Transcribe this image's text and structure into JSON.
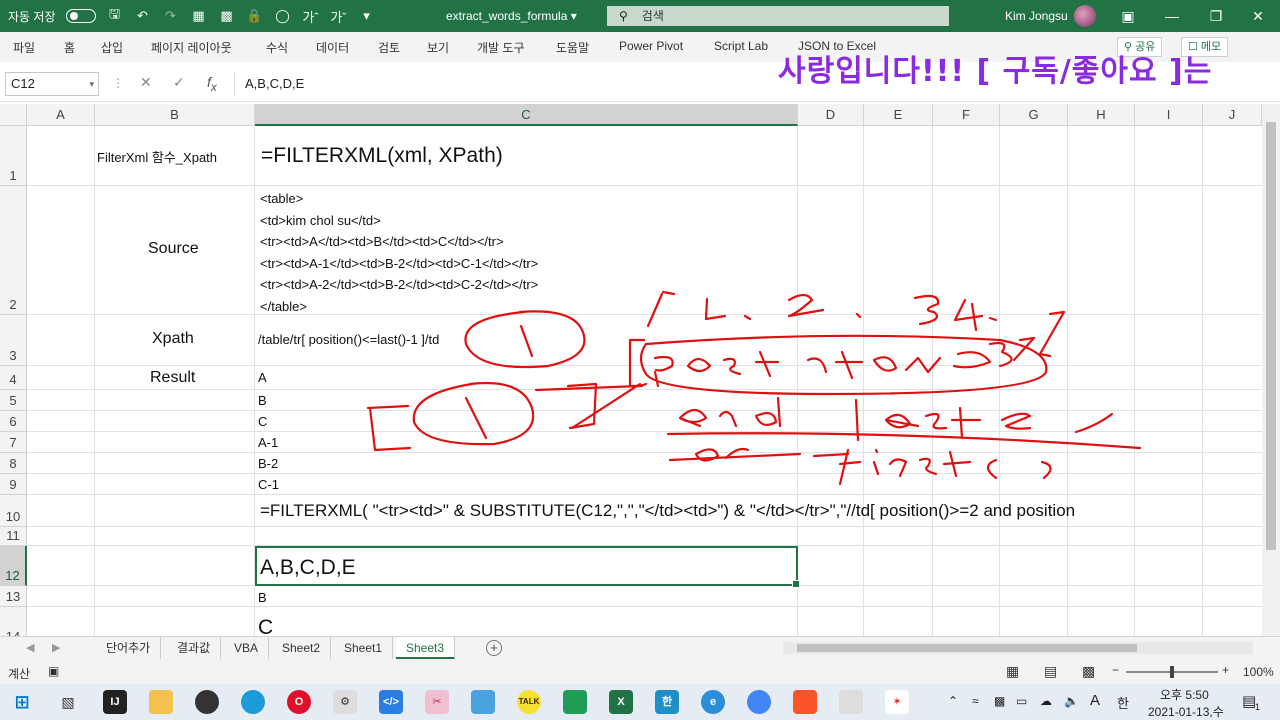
{
  "titlebar": {
    "autosave_label": "자동 저장",
    "filename": "extract_words_formula",
    "search_placeholder": "검색",
    "user_name": "Kim Jongsu"
  },
  "ribbon": {
    "tabs": [
      "파일",
      "홈",
      "삽입",
      "페이지 레이아웃",
      "수식",
      "데이터",
      "검토",
      "보기",
      "개발 도구",
      "도움말",
      "Power Pivot",
      "Script Lab",
      "JSON to Excel"
    ],
    "share_label": "공유",
    "memo_label": "메모"
  },
  "overlay_caption": "사랑입니다!!!   [   구독/좋아요 ]는",
  "formula_bar": {
    "name_box": "C12",
    "formula": "A,B,C,D,E"
  },
  "columns": [
    "A",
    "B",
    "C",
    "D",
    "E",
    "F",
    "G",
    "H",
    "I",
    "J"
  ],
  "rows": [
    "1",
    "2",
    "3",
    "4",
    "5",
    "6",
    "7",
    "8",
    "9",
    "10",
    "11",
    "12",
    "13",
    "14"
  ],
  "cells": {
    "b1": "FilterXml 함수_Xpath",
    "c1": "=FILTERXML(xml, XPath)",
    "b2": "Source",
    "c2_lines": [
      "<table>",
      "<td>kim chol su</td>",
      "<tr><td>A</td><td>B</td><td>C</td></tr>",
      "<tr><td>A-1</td><td>B-2</td><td>C-1</td></tr>",
      "<tr><td>A-2</td><td>B-2</td><td>C-2</td></tr>",
      "</table>"
    ],
    "b3": "Xpath",
    "c3": "/table/tr[ position()<=last()-1 ]/td",
    "b4": "Result",
    "results": [
      "A",
      "B",
      "C",
      "A-1",
      "B-2",
      "C-1"
    ],
    "c10": "=FILTERXML( \"<tr><td>\" & SUBSTITUTE(C12,\",\",\"</td><td>\") & \"</td></tr>\",\"//td[ position()>=2 and position",
    "c12": "A,B,C,D,E",
    "c13": "B",
    "c14": "C"
  },
  "sheets": {
    "tabs": [
      "단어추가",
      "결과값",
      "VBA",
      "Sheet2",
      "Sheet1",
      "Sheet3"
    ],
    "active": "Sheet3"
  },
  "status": {
    "mode": "계산",
    "zoom": "100%",
    "zoom_fraction": 0.5
  },
  "taskbar": {
    "time": "오후 5:50",
    "date": "2021-01-13,수",
    "lang_a": "A",
    "lang_han": "한",
    "notification_count": "1"
  },
  "colors": {
    "excel_green": "#217346",
    "caption_purple": "#8a2be2",
    "ink_red": "#e01010"
  }
}
